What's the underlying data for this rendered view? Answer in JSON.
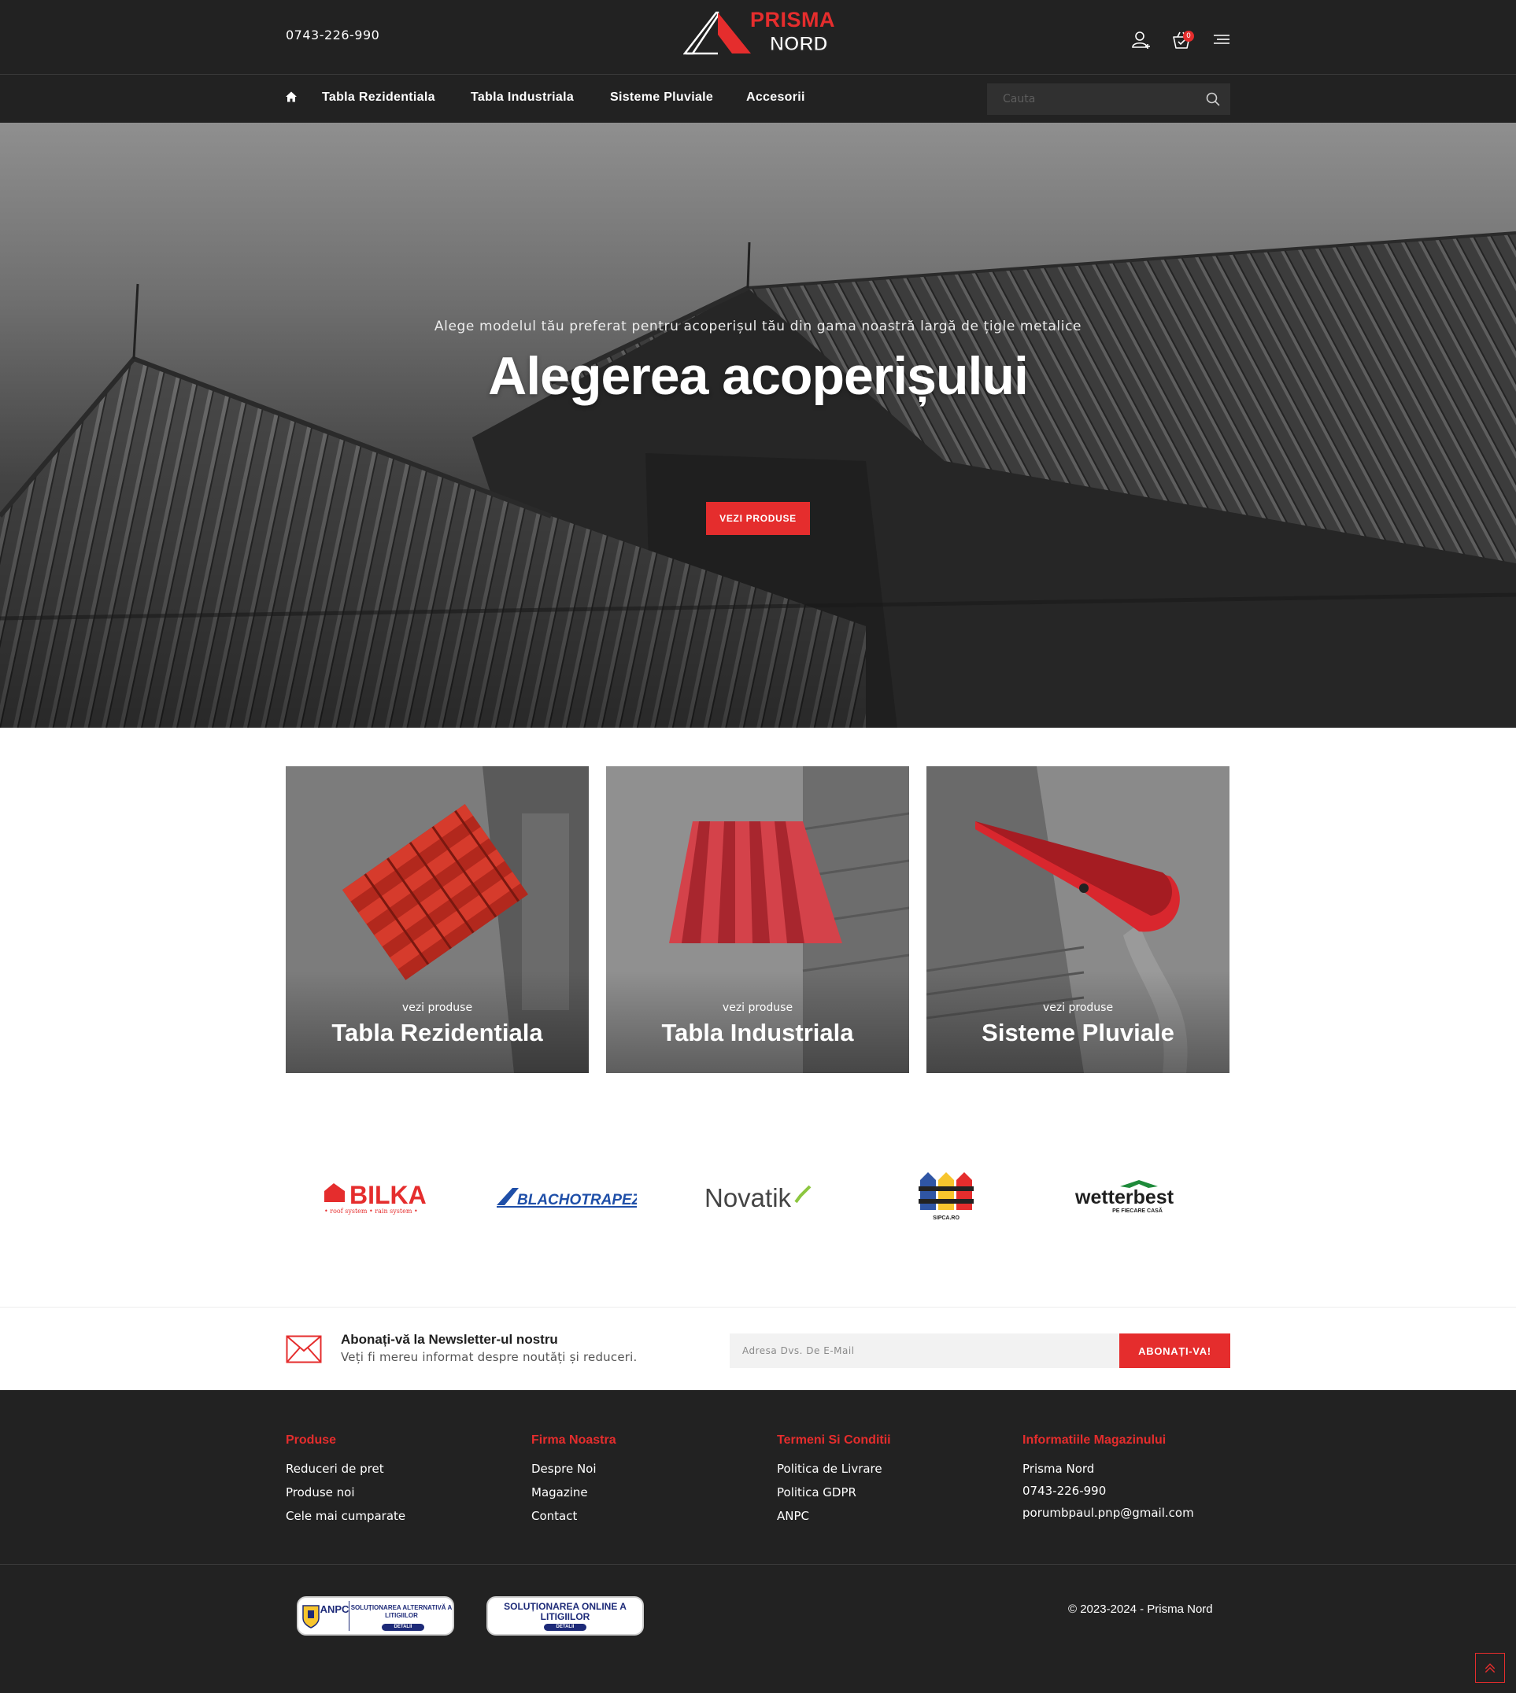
{
  "header": {
    "phone": "0743-226-990",
    "logo": {
      "top": "PRISMA",
      "bottom": "NORD"
    },
    "cart_count": "0",
    "icons": [
      "user-plus-icon",
      "cart-icon",
      "menu-icon"
    ]
  },
  "nav": {
    "home_icon": "home-icon",
    "items": [
      {
        "label": "Tabla Rezidentiala"
      },
      {
        "label": "Tabla Industriala"
      },
      {
        "label": "Sisteme Pluviale"
      },
      {
        "label": "Accesorii"
      }
    ],
    "search": {
      "placeholder": "Cauta"
    }
  },
  "hero": {
    "subtitle": "Alege modelul tău preferat pentru acoperișul tău din gama noastră largă de țigle metalice",
    "title": "Alegerea acoperișului",
    "button": "VEZI PRODUSE"
  },
  "categories": [
    {
      "sub": "vezi produse",
      "title": "Tabla Rezidentiala"
    },
    {
      "sub": "vezi produse",
      "title": "Tabla Industriala"
    },
    {
      "sub": "vezi produse",
      "title": "Sisteme Pluviale"
    }
  ],
  "brands": {
    "bilka": "BILKA",
    "bilka_tag": "• roof system • rain system •",
    "blachotrapez": "BLACHOTRAPEZ",
    "novatik": "Novatik",
    "sipca": "SIPCA.RO",
    "wetterbest": "wetterbest",
    "wetterbest_tag": "PE FIECARE CASĂ"
  },
  "newsletter": {
    "title": "Abonați-vă la Newsletter-ul nostru",
    "subtitle": "Veți fi mereu informat despre noutăți și reduceri.",
    "placeholder": "Adresa Dvs. De E-Mail",
    "button": "ABONAȚI-VA!"
  },
  "footer": {
    "columns": [
      {
        "heading": "Produse",
        "links": [
          "Reduceri de pret",
          "Produse noi",
          "Cele mai cumparate"
        ]
      },
      {
        "heading": "Firma Noastra",
        "links": [
          "Despre Noi",
          "Magazine",
          "Contact"
        ]
      },
      {
        "heading": "Termeni Si Conditii",
        "links": [
          "Politica de Livrare",
          "Politica GDPR",
          "ANPC"
        ]
      },
      {
        "heading": "Informatiile Magazinului",
        "links": [
          "Prisma Nord",
          "0743-226-990",
          "porumbpaul.pnp@gmail.com"
        ]
      }
    ],
    "badges": [
      {
        "anpc": "ANPC",
        "text": "SOLUȚIONAREA ALTERNATIVĂ A LITIGIILOR",
        "details": "DETALII"
      },
      {
        "text": "SOLUȚIONAREA ONLINE A LITIGIILOR",
        "details": "DETALII"
      }
    ],
    "copyright": "© 2023-2024 - Prisma Nord"
  },
  "colors": {
    "accent": "#e52d2d",
    "dark": "#222222"
  }
}
